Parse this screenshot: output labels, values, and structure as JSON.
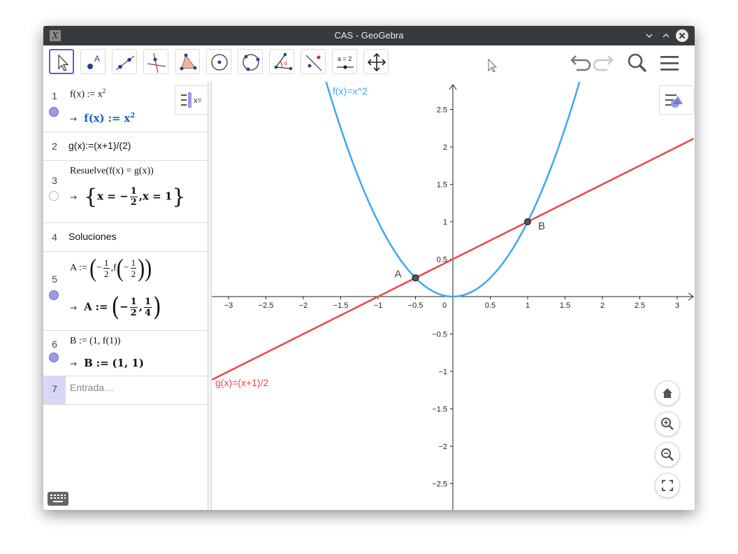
{
  "window": {
    "title": "CAS - GeoGebra",
    "app_icon": "geogebra-icon"
  },
  "toolbar": {
    "tools": [
      "move-tool-icon",
      "point-tool-icon",
      "line-tool-icon",
      "perpendicular-line-tool-icon",
      "polygon-tool-icon",
      "circle-center-tool-icon",
      "circle-three-points-tool-icon",
      "angle-tool-icon",
      "reflect-tool-icon",
      "slider-tool-icon",
      "move-graphics-tool-icon"
    ],
    "slider_label": "a = 2",
    "point_label": "A",
    "right": [
      "undo-icon",
      "redo-icon",
      "search-icon",
      "menu-icon"
    ]
  },
  "cas": {
    "rows": [
      {
        "num": "1",
        "input": "f(x) := x",
        "input_sup": "2",
        "output_name": "f(x)",
        "output_op": ":=",
        "output_val": "x",
        "output_sup": "2"
      },
      {
        "num": "2",
        "input": "g(x):=(x+1)/(2)"
      },
      {
        "num": "3",
        "input": "Resuelve(f(x) = g(x))",
        "out_open": "{",
        "out_x1": "x = −",
        "out_n": "1",
        "out_d": "2",
        "out_sep": ",",
        "out_x2": "x = 1",
        "out_close": "}"
      },
      {
        "num": "4",
        "input": "Soluciones"
      },
      {
        "num": "5",
        "input_a": "A := ",
        "in_minus": "−",
        "in_n": "1",
        "in_d": "2",
        "in_comma": ",",
        "in_f": "f",
        "in_minus2": "−",
        "in_n2": "1",
        "in_d2": "2",
        "output_name": "A",
        "output_op": ":=",
        "out_minus": "−",
        "out_n": "1",
        "out_d": "2",
        "out_comma": ",",
        "out_n2": "1",
        "out_d2": "4"
      },
      {
        "num": "6",
        "input": "B := (1, f(1))",
        "output_name": "B",
        "output_op": ":=",
        "output_val": "(1, 1)"
      },
      {
        "num": "7",
        "placeholder": "Entrada…"
      }
    ],
    "arrow": "→"
  },
  "chart_data": {
    "type": "line",
    "x_range": [
      -3.2,
      3.2
    ],
    "y_range": [
      -2.85,
      2.85
    ],
    "x_ticks": [
      "−3",
      "−2.5",
      "−2",
      "−1.5",
      "−1",
      "−0.5",
      "0",
      "0.5",
      "1",
      "1.5",
      "2",
      "2.5",
      "3"
    ],
    "y_ticks": [
      "−2.5",
      "−2",
      "−1.5",
      "−1",
      "−0.5",
      "0.5",
      "1",
      "1.5",
      "2",
      "2.5"
    ],
    "series": [
      {
        "name": "f(x)=x^2",
        "expr": "x^2",
        "color": "#42a5f5"
      },
      {
        "name": "g(x)=(x+1)/2",
        "expr": "(x+1)/2",
        "color": "#ef4444"
      }
    ],
    "points": [
      {
        "label": "A",
        "x": -0.5,
        "y": 0.25
      },
      {
        "label": "B",
        "x": 1,
        "y": 1
      }
    ],
    "grid": false
  },
  "graphics_buttons": [
    "home-icon",
    "zoom-in-icon",
    "zoom-out-icon",
    "fullscreen-icon"
  ]
}
